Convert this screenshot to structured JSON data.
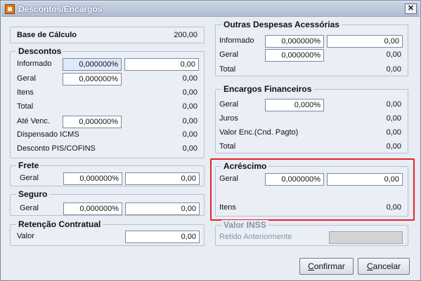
{
  "window": {
    "title": "Descontos/Encargos",
    "close_glyph": "✕"
  },
  "base": {
    "label": "Base de Cálculo",
    "value": "200,00"
  },
  "descontos": {
    "title": "Descontos",
    "informado_label": "Informado",
    "informado_pct": "0,000000%",
    "informado_val": "0,00",
    "geral_label": "Geral",
    "geral_pct": "0,000000%",
    "geral_val": "0,00",
    "itens_label": "Itens",
    "itens_val": "0,00",
    "total_label": "Total",
    "total_val": "0,00",
    "ate_venc_label": "Até Venc.",
    "ate_venc_pct": "0,000000%",
    "ate_venc_val": "0,00",
    "dispensado_label": "Dispensado ICMS",
    "dispensado_val": "0,00",
    "pis_label": "Desconto PIS/COFINS",
    "pis_val": "0,00"
  },
  "frete": {
    "title": "Frete",
    "geral_label": "Geral",
    "pct": "0,000000%",
    "val": "0,00"
  },
  "seguro": {
    "title": "Seguro",
    "geral_label": "Geral",
    "pct": "0,000000%",
    "val": "0,00"
  },
  "retencao": {
    "title": "Retenção Contratual",
    "valor_label": "Valor",
    "val": "0,00"
  },
  "outras": {
    "title": "Outras Despesas Acessórias",
    "informado_label": "Informado",
    "informado_pct": "0,000000%",
    "informado_val": "0,00",
    "geral_label": "Geral",
    "geral_pct": "0,000000%",
    "geral_val": "0,00",
    "total_label": "Total",
    "total_val": "0,00"
  },
  "encargos": {
    "title": "Encargos Financeiros",
    "geral_label": "Geral",
    "geral_pct": "0,000%",
    "geral_val": "0,00",
    "juros_label": "Juros",
    "juros_val": "0,00",
    "valor_enc_label": "Valor Enc.(Cnd. Pagto)",
    "valor_enc_val": "0,00",
    "total_label": "Total",
    "total_val": "0,00"
  },
  "acrescimo": {
    "title": "Acréscimo",
    "geral_label": "Geral",
    "geral_pct": "0,000000%",
    "geral_val": "0,00",
    "itens_label": "Itens",
    "itens_val": "0,00"
  },
  "inss": {
    "title": "Valor INSS",
    "retido_label": "Retido Anteriormente",
    "retido_val": ""
  },
  "buttons": {
    "confirmar_u": "C",
    "confirmar_rest": "onfirmar",
    "cancelar_u": "C",
    "cancelar_rest": "ancelar"
  },
  "colors": {
    "highlight": "#e0262a",
    "title_bar": "#b8c5d9"
  }
}
